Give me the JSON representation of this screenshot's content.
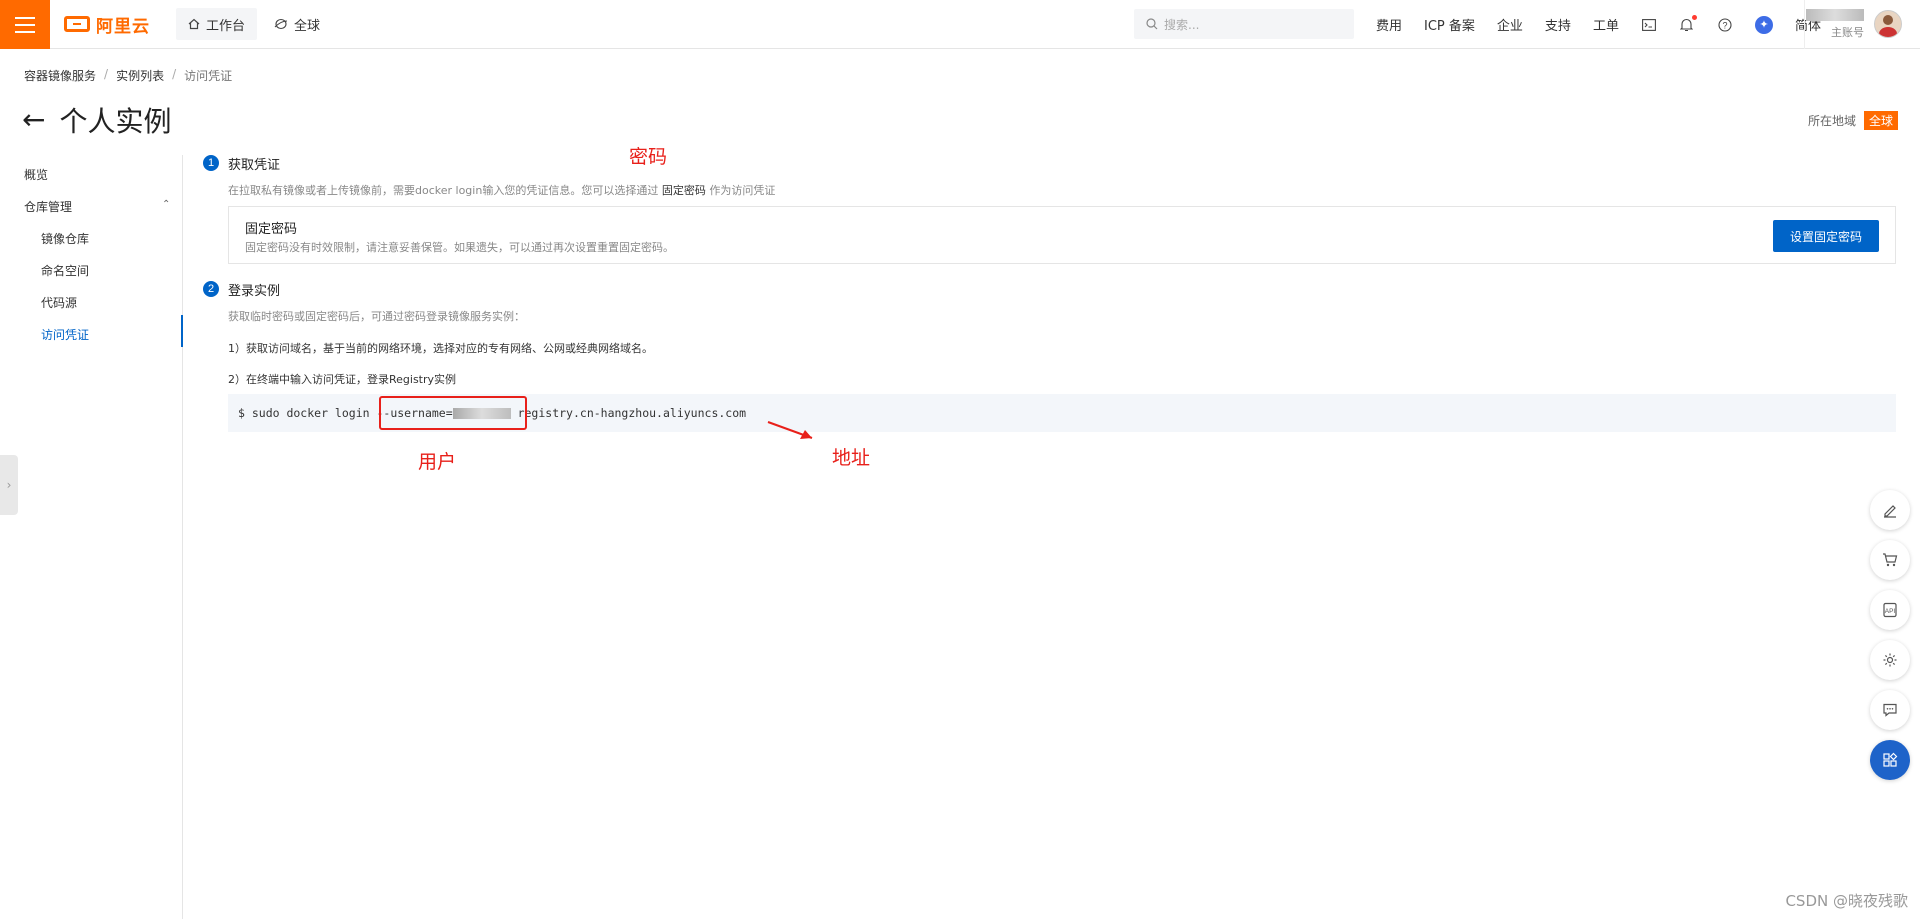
{
  "topbar": {
    "logo_text": "阿里云",
    "workbench_label": "工作台",
    "global_label": "全球",
    "search_placeholder": "搜索...",
    "links": [
      "费用",
      "ICP 备案",
      "企业",
      "支持",
      "工单"
    ],
    "lang_label": "简体",
    "account_label": "主账号"
  },
  "breadcrumb": [
    "容器镜像服务",
    "实例列表",
    "访问凭证"
  ],
  "page": {
    "title": "个人实例",
    "region_label": "所在地域",
    "region_value": "全球"
  },
  "sidenav": {
    "overview": "概览",
    "repo_mgmt": "仓库管理",
    "items": [
      "镜像仓库",
      "命名空间",
      "代码源",
      "访问凭证"
    ],
    "active": "访问凭证"
  },
  "step1": {
    "num": "1",
    "title": "获取凭证",
    "desc_prefix": "在拉取私有镜像或者上传镜像前，需要docker login输入您的凭证信息。您可以选择通过",
    "desc_bold": "固定密码",
    "desc_suffix": "作为访问凭证",
    "card_title": "固定密码",
    "card_desc": "固定密码没有时效限制，请注意妥善保管。如果遗失，可以通过再次设置重置固定密码。",
    "button_label": "设置固定密码"
  },
  "step2": {
    "num": "2",
    "title": "登录实例",
    "desc": "获取临时密码或固定密码后，可通过密码登录镜像服务实例：",
    "instr1": "1）获取访问域名，基于当前的网络环境，选择对应的专有网络、公网或经典网络域名。",
    "instr2": "2）在终端中输入访问凭证，登录Registry实例",
    "code_prefix": "$ sudo docker login ",
    "code_user": "--username=",
    "code_suffix": " registry.cn-hangzhou.aliyuncs.com"
  },
  "annotations": {
    "password": "密码",
    "user": "用户",
    "address": "地址"
  },
  "watermark": "CSDN @晓夜残歌",
  "colors": {
    "brand": "#ff6a00",
    "primary": "#0064c8",
    "annotation": "#e8201a"
  }
}
